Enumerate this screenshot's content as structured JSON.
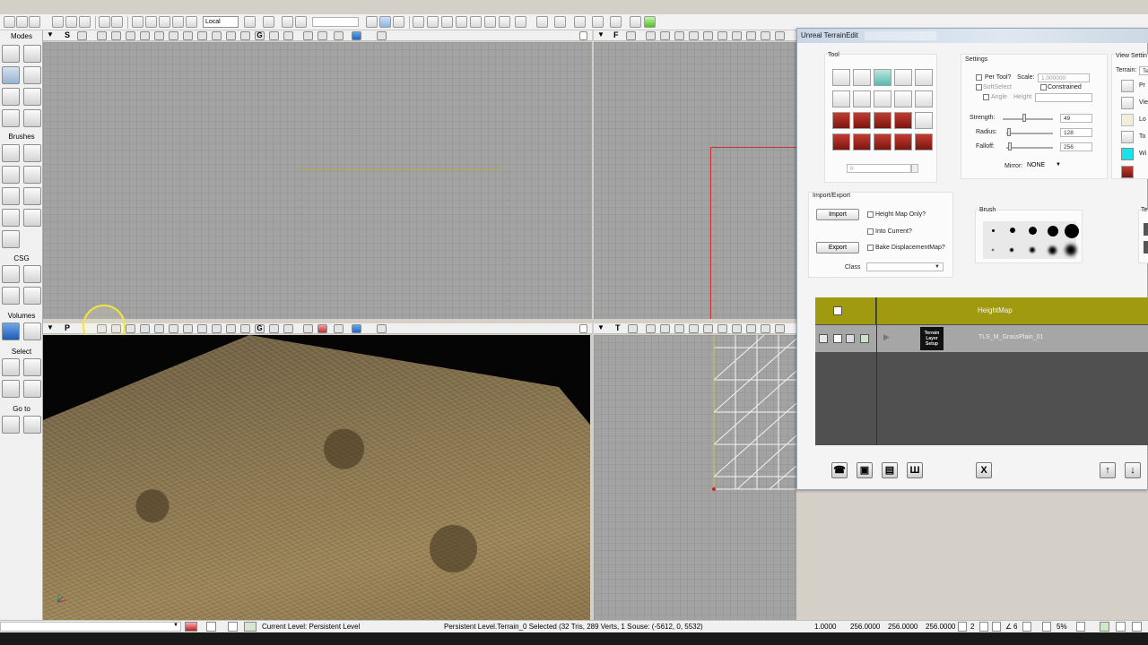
{
  "toolbar": {
    "coordinate_system": "Local"
  },
  "modes_panel": {
    "title": "Modes",
    "sections": {
      "brushes": "Brushes",
      "csg": "CSG",
      "volumes": "Volumes",
      "select": "Select",
      "goto": "Go to"
    }
  },
  "viewports": {
    "top_left_mode": "S",
    "top_right_mode": "F",
    "bottom_left_mode": "P",
    "bottom_right_mode": "T"
  },
  "terrain_edit": {
    "title": "Unreal TerrainEdit",
    "tool_group_label": "Tool",
    "tool_value": "0",
    "settings": {
      "label": "Settings",
      "per_tool": "Per Tool?",
      "scale_label": "Scale:",
      "scale_value": "1.000000",
      "soft_select": "SoftSelect",
      "constrained": "Constrained",
      "angle": "Angle",
      "height": "Height",
      "strength_label": "Strength:",
      "strength_value": "49",
      "strength_level": 0.42,
      "radius_label": "Radius:",
      "radius_value": "128",
      "radius_level": 0.05,
      "falloff_label": "Falloff:",
      "falloff_value": "256",
      "falloff_level": 0.08,
      "mirror_label": "Mirror:",
      "mirror_value": "NONE"
    },
    "view_settings": {
      "label": "View Settin",
      "terrain_label": "Terrain:",
      "terrain_value": "Te",
      "items": [
        "Pr",
        "Vie",
        "Lo",
        "To",
        "Wi"
      ]
    },
    "import_export": {
      "label": "Import/Export",
      "import_button": "Import",
      "export_button": "Export",
      "height_map_only": "Height Map Only?",
      "into_current": "Into Current?",
      "bake_displacement": "Bake DisplacementMap?",
      "class_label": "Class"
    },
    "brush_label": "Brush",
    "te_label": "Te",
    "layers": {
      "header": "HeightMap",
      "row_thumb_text": "Terrain Layer Setup",
      "row_name": "TLS_M_GrassPlain_01"
    }
  },
  "status_bar": {
    "current_level": "Current Level:  Persistent Level",
    "selection_info": "Persistent Level.Terrain_0 Selected (32 Tris, 289 Verts, 1 Sections)",
    "mouse_info": "ouse: (-5612, 0, 5532)",
    "fields": [
      "1.0000",
      "256.0000",
      "256.0000",
      "256.0000"
    ],
    "grid_value": "2",
    "angle_value": "6",
    "scale_value": "5%"
  },
  "colors": {
    "grid_bg": "#a3a3a3",
    "layer_header": "#a09a10",
    "highlight_cursor": "#f2e63a",
    "brush_outline_red": "#c83030",
    "brush_outline_olive": "#b3a84a"
  }
}
